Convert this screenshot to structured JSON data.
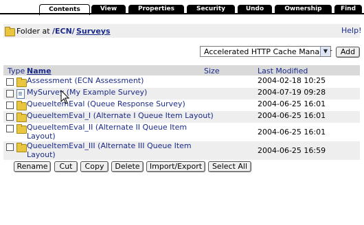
{
  "tabs": [
    {
      "label": "Contents",
      "active": true
    },
    {
      "label": "View"
    },
    {
      "label": "Properties"
    },
    {
      "label": "Security"
    },
    {
      "label": "Undo"
    },
    {
      "label": "Ownership"
    },
    {
      "label": "Find"
    }
  ],
  "header": {
    "folder_prefix": "Folder at",
    "path_root": "/ECN/",
    "path_current": "Surveys",
    "help": "Help!"
  },
  "add_select": {
    "selected": "Accelerated HTTP Cache Manager",
    "add_label": "Add"
  },
  "table": {
    "col_type": "Type",
    "col_name": "Name",
    "col_size": "Size",
    "col_modified": "Last Modified",
    "rows": [
      {
        "icon": "folder-icon",
        "name": "Assessment (ECN Assessment)",
        "modified": "2004-02-18 10:25"
      },
      {
        "icon": "survey-document-icon",
        "name": "MySurvey (My Example Survey)",
        "modified": "2004-07-19 09:28"
      },
      {
        "icon": "folder-icon",
        "name": "QueueItemEval (Queue Response Survey)",
        "modified": "2004-06-25 16:01"
      },
      {
        "icon": "folder-icon",
        "name": "QueueItemEval_I (Alternate I Queue Item Layout)",
        "modified": "2004-06-25 16:01"
      },
      {
        "icon": "folder-icon",
        "name_line1": "QueueItemEval_II (Alternate II Queue Item",
        "name_line2": "Layout)",
        "modified": "2004-06-25 16:01"
      },
      {
        "icon": "folder-icon",
        "name_line1": "QueueItemEval_III (Alternate III Queue Item",
        "name_line2": "Layout)",
        "modified": "2004-06-25 16:59"
      }
    ]
  },
  "actions": {
    "rename": "Rename",
    "cut": "Cut",
    "copy": "Copy",
    "delete": "Delete",
    "import_export": "Import/Export",
    "select_all": "Select All"
  }
}
